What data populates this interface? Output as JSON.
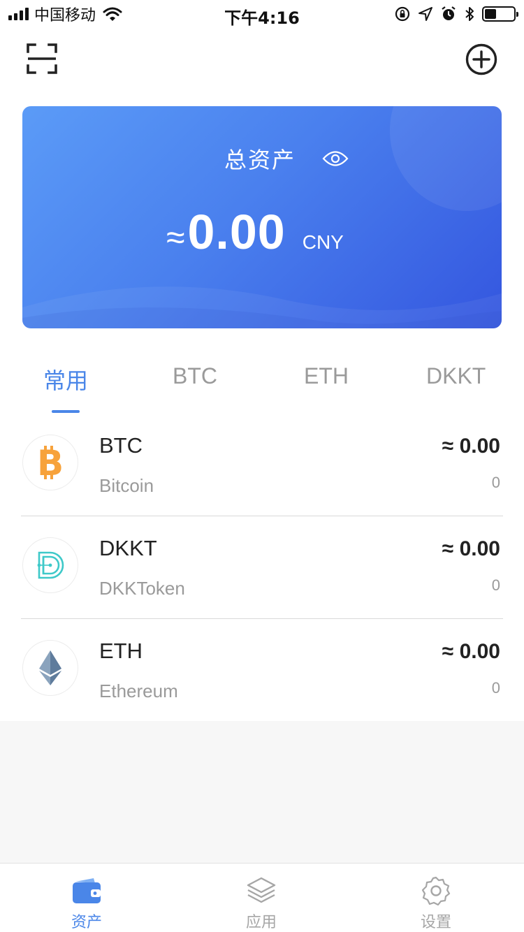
{
  "status_bar": {
    "carrier": "中国移动",
    "time": "下午4:16"
  },
  "card": {
    "title": "总资产",
    "approx_symbol": "≈",
    "amount": "0.00",
    "currency": "CNY"
  },
  "tabs": [
    {
      "label": "常用",
      "active": true
    },
    {
      "label": "BTC",
      "active": false
    },
    {
      "label": "ETH",
      "active": false
    },
    {
      "label": "DKKT",
      "active": false
    }
  ],
  "assets": [
    {
      "symbol": "BTC",
      "name": "Bitcoin",
      "value": "≈ 0.00",
      "quantity": "0",
      "icon": "bitcoin-icon"
    },
    {
      "symbol": "DKKT",
      "name": "DKKToken",
      "value": "≈ 0.00",
      "quantity": "0",
      "icon": "dkkt-icon"
    },
    {
      "symbol": "ETH",
      "name": "Ethereum",
      "value": "≈ 0.00",
      "quantity": "0",
      "icon": "ethereum-icon"
    }
  ],
  "bottom_nav": [
    {
      "label": "资产",
      "icon": "wallet-icon",
      "active": true
    },
    {
      "label": "应用",
      "icon": "layers-icon",
      "active": false
    },
    {
      "label": "设置",
      "icon": "gear-icon",
      "active": false
    }
  ],
  "colors": {
    "accent": "#4a86e8",
    "card_start": "#5b9bf7",
    "card_end": "#3456df",
    "bitcoin": "#f7a23b",
    "dkkt": "#3ec9c9",
    "ethereum": "#6f8ba8"
  }
}
